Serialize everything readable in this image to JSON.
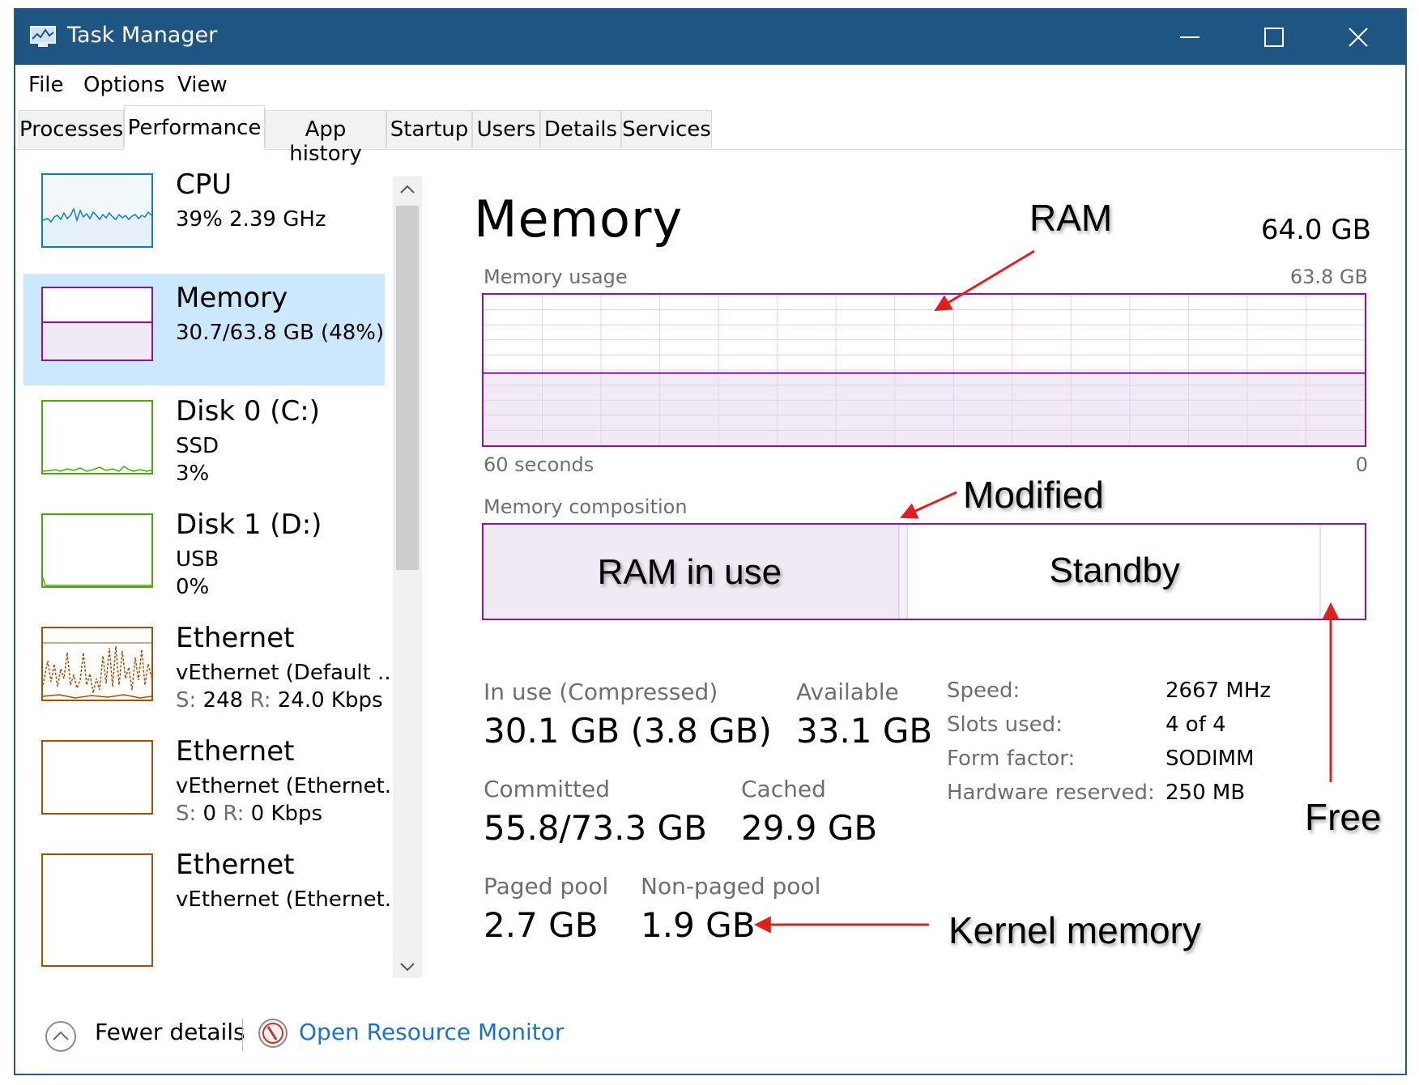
{
  "window": {
    "title": "Task Manager",
    "icon": "task-manager-icon",
    "controls": [
      "minimize-icon",
      "maximize-icon",
      "close-icon"
    ]
  },
  "menu": [
    "File",
    "Options",
    "View"
  ],
  "tabs": [
    "Processes",
    "Performance",
    "App history",
    "Startup",
    "Users",
    "Details",
    "Services"
  ],
  "active_tab": "Performance",
  "sidebar": {
    "items": [
      {
        "name": "CPU",
        "line2": "39%  2.39 GHz",
        "line3": "",
        "color": "#117dbb"
      },
      {
        "name": "Memory",
        "line2": "30.7/63.8 GB (48%)",
        "line3": "",
        "color": "#8b12ae"
      },
      {
        "name": "Disk 0 (C:)",
        "line2": "SSD",
        "line3": "3%",
        "color": "#4da60c"
      },
      {
        "name": "Disk 1 (D:)",
        "line2": "USB",
        "line3": "0%",
        "color": "#4da60c"
      },
      {
        "name": "Ethernet",
        "line2": "vEthernet (Default ...",
        "line3_label_s": "S:",
        "line3_value_s": "248",
        "line3_label_r": "R:",
        "line3_value_r": "24.0 Kbps",
        "color": "#a74f01"
      },
      {
        "name": "Ethernet",
        "line2": "vEthernet (Ethernet...",
        "line3_label_s": "S:",
        "line3_value_s": "0",
        "line3_label_r": "R:",
        "line3_value_r": "0 Kbps",
        "color": "#a74f01"
      },
      {
        "name": "Ethernet",
        "line2": "vEthernet (Ethernet...",
        "line3": "",
        "color": "#a74f01"
      }
    ],
    "selected": "Memory"
  },
  "memory": {
    "title": "Memory",
    "total": "64.0 GB",
    "usage_label": "Memory usage",
    "usage_max": "63.8 GB",
    "time_left": "60 seconds",
    "time_right": "0",
    "usage_fraction": 0.48,
    "composition_label": "Memory composition",
    "composition": {
      "in_use_label": "RAM in use",
      "standby_label": "Standby",
      "in_use_gb": 30.1,
      "modified_gb": 0.6,
      "standby_gb": 29.9,
      "free_gb": 3.2
    },
    "stats": {
      "in_use_label": "In use (Compressed)",
      "in_use_value": "30.1 GB (3.8 GB)",
      "available_label": "Available",
      "available_value": "33.1 GB",
      "committed_label": "Committed",
      "committed_value": "55.8/73.3 GB",
      "cached_label": "Cached",
      "cached_value": "29.9 GB",
      "paged_label": "Paged pool",
      "paged_value": "2.7 GB",
      "nonpaged_label": "Non-paged pool",
      "nonpaged_value": "1.9 GB"
    },
    "specs": [
      {
        "label": "Speed:",
        "value": "2667 MHz"
      },
      {
        "label": "Slots used:",
        "value": "4 of 4"
      },
      {
        "label": "Form factor:",
        "value": "SODIMM"
      },
      {
        "label": "Hardware reserved:",
        "value": "250 MB"
      }
    ]
  },
  "annotations": {
    "ram": "RAM",
    "modified": "Modified",
    "free": "Free",
    "kernel": "Kernel memory",
    "arrow_color": "#e02020"
  },
  "footer": {
    "fewer_details": "Fewer details",
    "open_resmon": "Open Resource Monitor"
  },
  "colors": {
    "titlebar": "#1f5582",
    "memory_accent": "#8b12ae",
    "selected_bg": "#cce8ff",
    "link": "#1a73c8"
  }
}
